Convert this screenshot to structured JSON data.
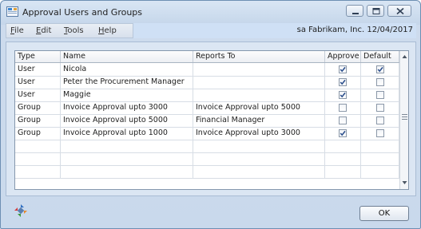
{
  "window": {
    "title": "Approval Users and Groups"
  },
  "menu": {
    "items": [
      {
        "label": "File",
        "accel": "F",
        "rest": "ile"
      },
      {
        "label": "Edit",
        "accel": "E",
        "rest": "dit"
      },
      {
        "label": "Tools",
        "accel": "T",
        "rest": "ools"
      },
      {
        "label": "Help",
        "accel": "H",
        "rest": "elp"
      }
    ]
  },
  "session": {
    "info": "sa  Fabrikam, Inc.  12/04/2017"
  },
  "table": {
    "headers": [
      "Type",
      "Name",
      "Reports To",
      "Approve",
      "Default"
    ],
    "rows": [
      {
        "type": "User",
        "name": "Nicola",
        "reports_to": "",
        "approve": true,
        "default": true
      },
      {
        "type": "User",
        "name": "Peter the Procurement Manager",
        "reports_to": "",
        "approve": true,
        "default": false
      },
      {
        "type": "User",
        "name": "Maggie",
        "reports_to": "",
        "approve": true,
        "default": false
      },
      {
        "type": "Group",
        "name": "Invoice Approval upto 3000",
        "reports_to": "Invoice Approval upto 5000",
        "approve": false,
        "default": false
      },
      {
        "type": "Group",
        "name": "Invoice Approval upto 5000",
        "reports_to": "Financial Manager",
        "approve": false,
        "default": false
      },
      {
        "type": "Group",
        "name": "Invoice Approval upto 1000",
        "reports_to": "Invoice Approval upto 3000",
        "approve": true,
        "default": false
      }
    ],
    "empty_rows": 3
  },
  "buttons": {
    "ok": "OK"
  },
  "icons": {
    "app": "window-app-icon",
    "minimize": "minimize-icon",
    "maximize": "maximize-icon",
    "close": "close-icon",
    "footer": "dynamics-logo-icon",
    "check": "checkmark-icon"
  }
}
